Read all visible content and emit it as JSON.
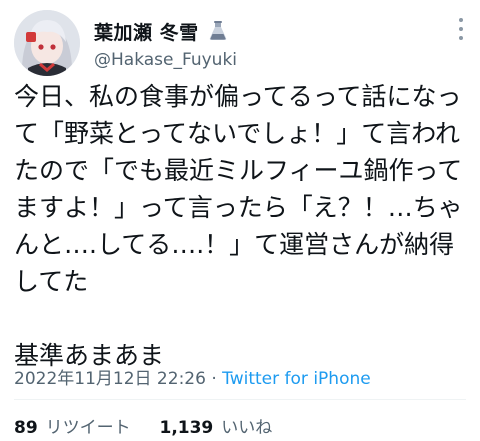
{
  "user": {
    "display_name": "葉加瀬 冬雪",
    "handle": "@Hakase_Fuyuki",
    "verified_icon": "flask-icon"
  },
  "tweet": {
    "text": "今日、私の食事が偏ってるって話になって「野菜とってないでしょ！」て言われたので「でも最近ミルフィーユ鍋作ってますよ！」って言ったら「え？！…ちゃんと….してる….！」て運営さんが納得してた\n\n基準あまあま",
    "timestamp": "2022年11月12日 22:26",
    "separator": "·",
    "source": "Twitter for iPhone"
  },
  "stats": {
    "retweets_count": "89",
    "retweets_label": "リツイート",
    "likes_count": "1,139",
    "likes_label": "いいね"
  },
  "colors": {
    "text": "#0f1419",
    "secondary": "#536471",
    "link": "#1d9bf0",
    "divider": "#eff3f4"
  }
}
